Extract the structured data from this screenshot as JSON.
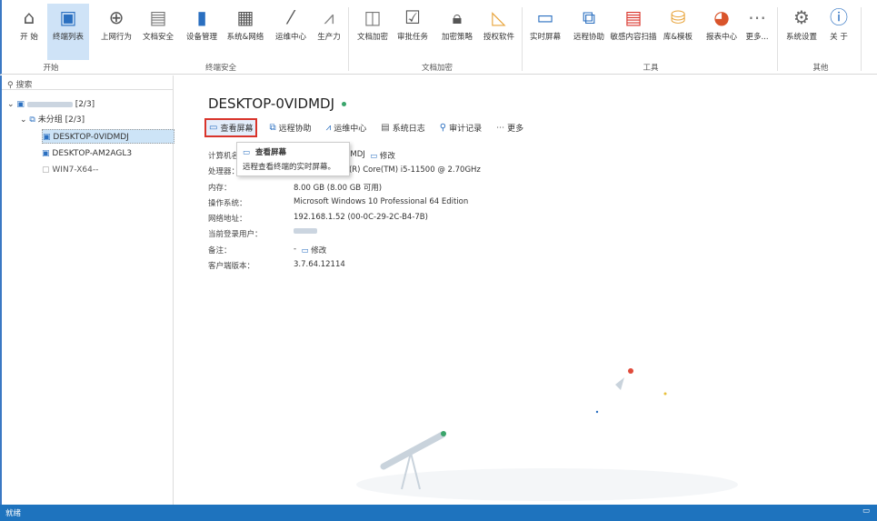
{
  "ribbon": {
    "groups": [
      {
        "label": "开始"
      },
      {
        "label": "终端安全"
      },
      {
        "label": "文档加密"
      },
      {
        "label": "工具"
      },
      {
        "label": "其他"
      }
    ],
    "items": [
      {
        "label": "开 始",
        "icon": "home-icon"
      },
      {
        "label": "终端列表",
        "icon": "computers-icon"
      },
      {
        "label": "上网行为",
        "icon": "globe-search-icon"
      },
      {
        "label": "文档安全",
        "icon": "document-shield-icon"
      },
      {
        "label": "设备管理",
        "icon": "usb-tool-icon"
      },
      {
        "label": "系统&网络",
        "icon": "firewall-shield-icon"
      },
      {
        "label": "运维中心",
        "icon": "magic-wand-icon"
      },
      {
        "label": "生产力",
        "icon": "chart-user-icon"
      },
      {
        "label": "文档加密",
        "icon": "box-shield-icon"
      },
      {
        "label": "审批任务",
        "icon": "clipboard-check-icon"
      },
      {
        "label": "加密策略",
        "icon": "lock-window-icon"
      },
      {
        "label": "授权软件",
        "icon": "ruler-pencil-icon"
      },
      {
        "label": "实时屏幕",
        "icon": "monitor-icon"
      },
      {
        "label": "远程协助",
        "icon": "remote-screens-icon"
      },
      {
        "label": "敏感内容扫描",
        "icon": "scan-document-icon"
      },
      {
        "label": "库&模板",
        "icon": "database-icon"
      },
      {
        "label": "报表中心",
        "icon": "pie-chart-icon"
      },
      {
        "label": "更多...",
        "icon": "more-icon"
      },
      {
        "label": "系统设置",
        "icon": "gear-icon"
      },
      {
        "label": "关 于",
        "icon": "info-icon"
      }
    ]
  },
  "tree": {
    "search_placeholder": "搜索",
    "root_count": "[2/3]",
    "group_label": "未分组",
    "group_count": "[2/3]",
    "nodes": [
      "DESKTOP-0VIDMDJ",
      "DESKTOP-AM2AGL3",
      "WIN7-X64--"
    ]
  },
  "main": {
    "title": "DESKTOP-0VIDMDJ",
    "actions": [
      "查看屏幕",
      "远程协助",
      "运维中心",
      "系统日志",
      "审计记录",
      "更多"
    ],
    "tooltip": {
      "title": "查看屏幕",
      "desc": "远程查看终端的实时屏幕。"
    },
    "info": [
      {
        "k": "计算机名：",
        "v": "DESKTOP-0VIDMDJ",
        "edit": "修改"
      },
      {
        "k": "处理器：",
        "v": "11th Gen Intel(R) Core(TM) i5-11500 @ 2.70GHz"
      },
      {
        "k": "内存：",
        "v": "8.00 GB (8.00 GB 可用)"
      },
      {
        "k": "操作系统：",
        "v": "Microsoft Windows 10 Professional 64 Edition"
      },
      {
        "k": "网络地址：",
        "v": "192.168.1.52  (00-0C-29-2C-B4-7B)"
      },
      {
        "k": "当前登录用户：",
        "v": ""
      },
      {
        "k": "备注：",
        "v": "-",
        "edit": "修改"
      },
      {
        "k": "客户端版本：",
        "v": "3.7.64.12114"
      }
    ]
  },
  "status": {
    "text": "就绪"
  },
  "colors": {
    "accent": "#1e73be",
    "highlight": "#d9342b",
    "online": "#3aa56b"
  }
}
